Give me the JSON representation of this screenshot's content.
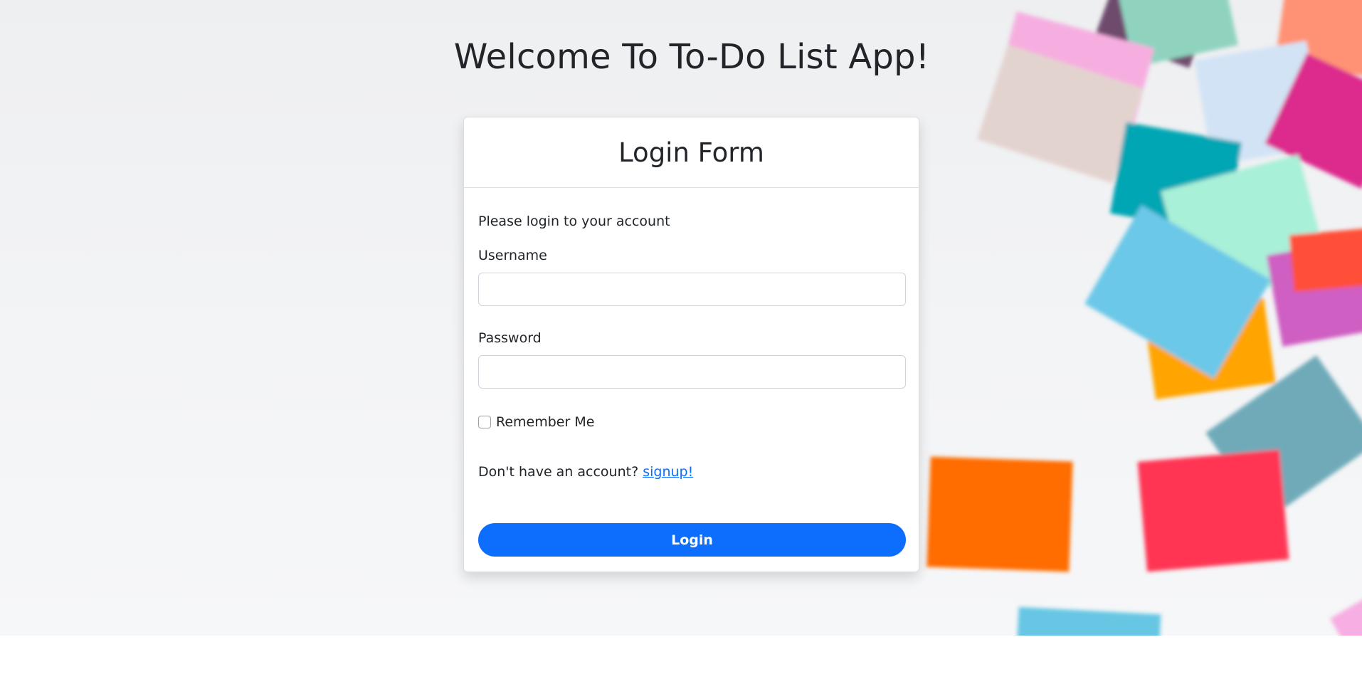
{
  "page": {
    "welcome_title": "Welcome To To-Do List App!"
  },
  "login_card": {
    "title": "Login Form",
    "intro": "Please login to your account",
    "username_label": "Username",
    "username_value": "",
    "password_label": "Password",
    "password_value": "",
    "remember_label": "Remember Me",
    "remember_checked": false,
    "signup_prompt": "Don't have an account?",
    "signup_link": "signup!",
    "login_button": "Login"
  },
  "colors": {
    "primary": "#0d6efd",
    "text": "#212529",
    "background": "#f1f2f4"
  }
}
